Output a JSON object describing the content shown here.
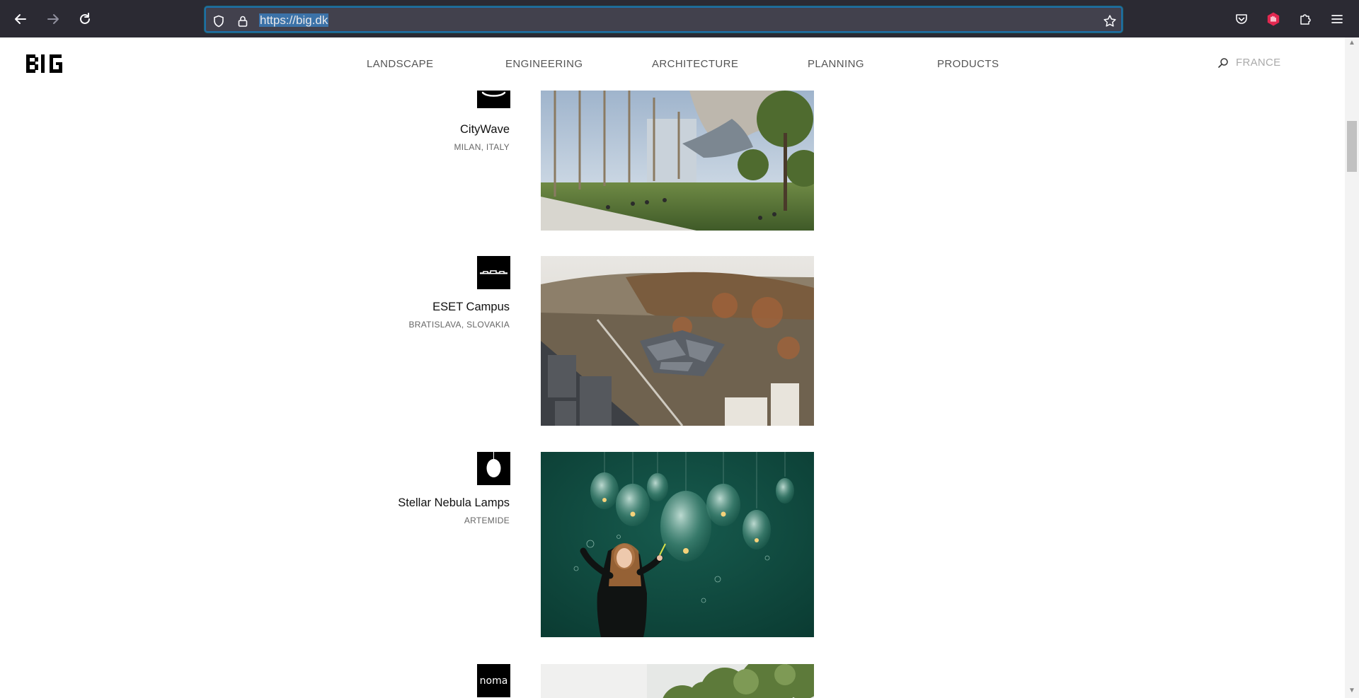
{
  "browser": {
    "url": "https://big.dk",
    "icons": [
      "back-arrow-icon",
      "forward-arrow-icon",
      "reload-icon",
      "shield-icon",
      "lock-icon",
      "star-icon",
      "pocket-icon",
      "extension-block-icon",
      "puzzle-icon",
      "menu-icon"
    ]
  },
  "site": {
    "logo_text": "BIG",
    "nav": [
      "LANDSCAPE",
      "ENGINEERING",
      "ARCHITECTURE",
      "PLANNING",
      "PRODUCTS"
    ],
    "search_label": "FRANCE"
  },
  "projects": [
    {
      "title": "CityWave",
      "location": "MILAN, ITALY"
    },
    {
      "title": "ESET Campus",
      "location": "BRATISLAVA, SLOVAKIA"
    },
    {
      "title": "Stellar Nebula Lamps",
      "location": "ARTEMIDE"
    },
    {
      "title": "",
      "location": "",
      "icon_text": "noma"
    }
  ],
  "colors": {
    "chrome": "#2b2a33",
    "url_focus": "#1e6ea7",
    "url_selection": "#3b72a8",
    "lamp_bg": "#0e4a3f"
  }
}
